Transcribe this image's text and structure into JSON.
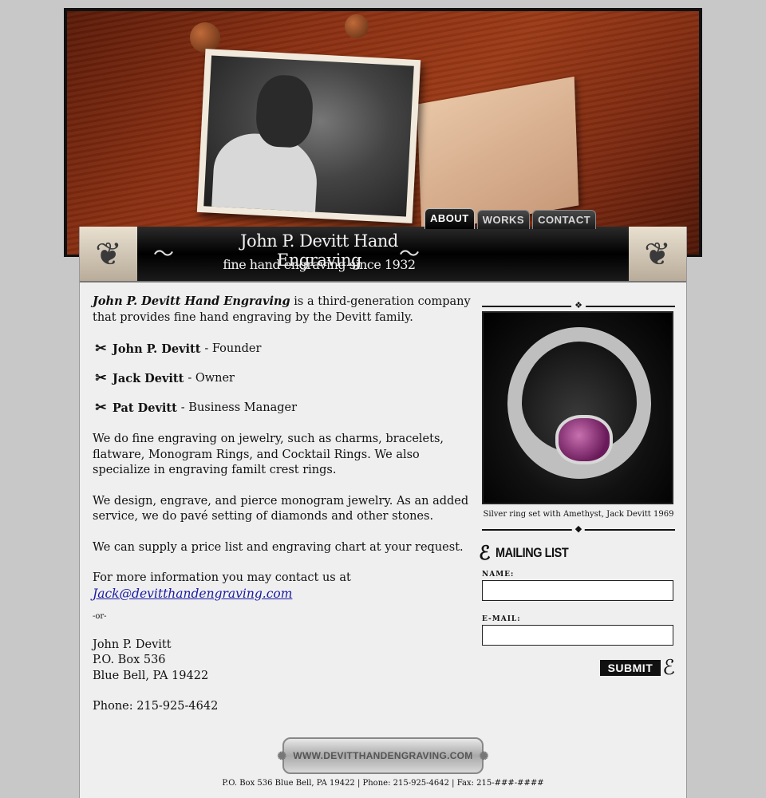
{
  "nav": {
    "tabs": [
      {
        "label": "ABOUT",
        "active": true
      },
      {
        "label": "WORKS",
        "active": false
      },
      {
        "label": "CONTACT",
        "active": false
      }
    ]
  },
  "banner": {
    "title": "John P. Devitt Hand Engraving",
    "subtitle": "fine hand engraving since 1932"
  },
  "content": {
    "intro_name": "John P. Devitt Hand Engraving",
    "intro_rest": " is a third-generation company that provides fine hand engraving by the Devitt family.",
    "people": [
      {
        "name": "John P. Devitt",
        "role": "- Founder"
      },
      {
        "name": "Jack Devitt",
        "role": "- Owner"
      },
      {
        "name": "Pat Devitt",
        "role": "- Business Manager"
      }
    ],
    "para1": "We do fine engraving on jewelry, such as charms, bracelets, flatware, Monogram Rings, and Cocktail Rings. We also specialize in engraving familt crest rings.",
    "para2": "We design, engrave, and pierce monogram jewelry. As an added service, we do pavé setting of diamonds and other stones.",
    "para3": "We can supply a price list and engraving chart at your request.",
    "contact_intro": "For more information you may contact us at",
    "email": "Jack@devitthandengraving.com",
    "or": "-or-",
    "address": [
      "John P. Devitt",
      "P.O. Box 536",
      "Blue Bell, PA 19422"
    ],
    "phone": "Phone: 215-925-4642"
  },
  "sidebar": {
    "caption": "Silver ring set with Amethyst, Jack Devitt 1969",
    "mailing_title": "MAILING LIST",
    "name_label": "NAME:",
    "email_label": "E-MAIL:",
    "submit_label": "SUBMIT"
  },
  "footer": {
    "badge": "WWW.DEVITTHANDENGRAVING.COM",
    "line": "P.O. Box 536 Blue Bell, PA 19422 | Phone: 215-925-4642 | Fax: 215-###-####"
  },
  "colors": {
    "link": "#1a1aa6",
    "page_bg": "#c8c8c8",
    "content_bg": "#efefef"
  }
}
